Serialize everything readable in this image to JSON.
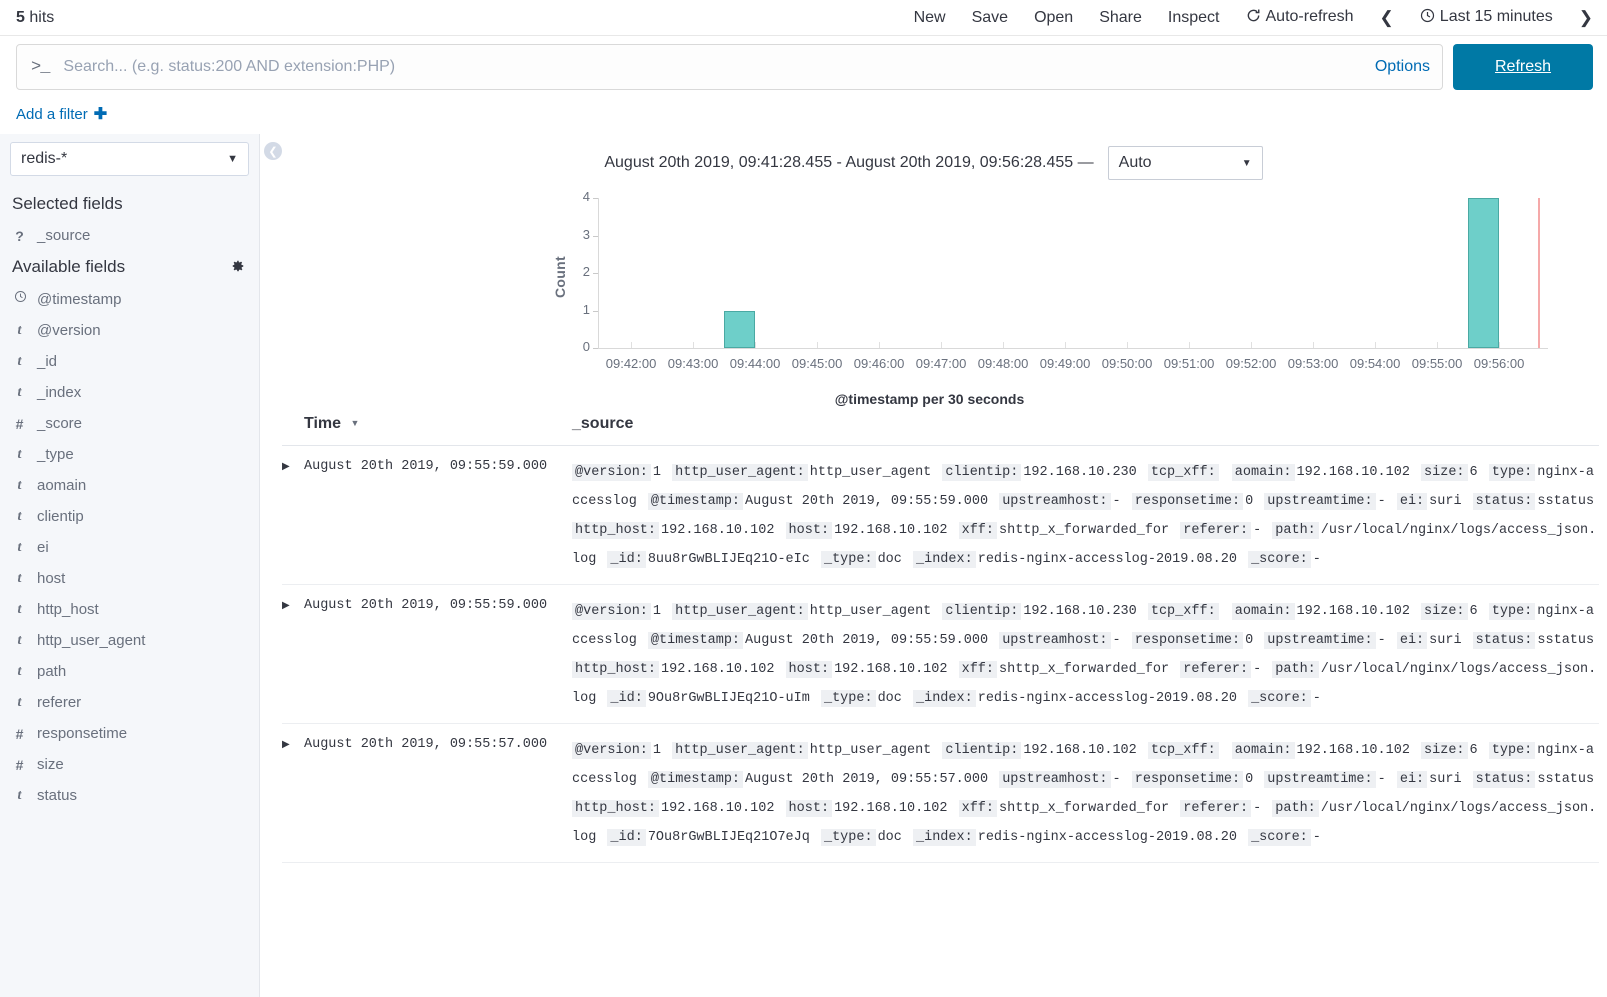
{
  "header": {
    "hits_count": "5",
    "hits_label": "hits",
    "nav": [
      {
        "label": "New",
        "name": "new"
      },
      {
        "label": "Save",
        "name": "save"
      },
      {
        "label": "Open",
        "name": "open"
      },
      {
        "label": "Share",
        "name": "share"
      },
      {
        "label": "Inspect",
        "name": "inspect"
      }
    ],
    "auto_refresh": "Auto-refresh",
    "auto_refresh_icon": "refresh-icon",
    "prev_icon": "chevron-left-icon",
    "next_icon": "chevron-right-icon",
    "time_picker": "Last 15 minutes",
    "clock_icon": "clock-icon"
  },
  "query": {
    "prompt_icon": "console-prompt-icon",
    "placeholder": "Search... (e.g. status:200 AND extension:PHP)",
    "value": "",
    "options_label": "Options",
    "refresh_label": "Refresh"
  },
  "filters": {
    "add_filter_label": "Add a filter",
    "plus_icon": "plus-icon"
  },
  "sidebar": {
    "index_pattern": "redis-*",
    "selected_fields_label": "Selected fields",
    "available_fields_label": "Available fields",
    "settings_icon": "gear-icon",
    "selected_fields": [
      {
        "name": "_source",
        "type": "?"
      }
    ],
    "available_fields": [
      {
        "name": "@timestamp",
        "type": "clock"
      },
      {
        "name": "@version",
        "type": "t"
      },
      {
        "name": "_id",
        "type": "t"
      },
      {
        "name": "_index",
        "type": "t"
      },
      {
        "name": "_score",
        "type": "#"
      },
      {
        "name": "_type",
        "type": "t"
      },
      {
        "name": "aomain",
        "type": "t"
      },
      {
        "name": "clientip",
        "type": "t"
      },
      {
        "name": "ei",
        "type": "t"
      },
      {
        "name": "host",
        "type": "t"
      },
      {
        "name": "http_host",
        "type": "t"
      },
      {
        "name": "http_user_agent",
        "type": "t"
      },
      {
        "name": "path",
        "type": "t"
      },
      {
        "name": "referer",
        "type": "t"
      },
      {
        "name": "responsetime",
        "type": "#"
      },
      {
        "name": "size",
        "type": "#"
      },
      {
        "name": "status",
        "type": "t"
      }
    ]
  },
  "chart_header": {
    "range_text": "August 20th 2019, 09:41:28.455 - August 20th 2019, 09:56:28.455 —",
    "interval": "Auto",
    "collapse_icon": "collapse-left-icon"
  },
  "chart_data": {
    "type": "bar",
    "title": "",
    "xlabel": "@timestamp per 30 seconds",
    "ylabel": "Count",
    "ylim": [
      0,
      4
    ],
    "yticks": [
      0,
      1,
      2,
      3,
      4
    ],
    "xticks": [
      "09:42:00",
      "09:43:00",
      "09:44:00",
      "09:45:00",
      "09:46:00",
      "09:47:00",
      "09:48:00",
      "09:49:00",
      "09:50:00",
      "09:51:00",
      "09:52:00",
      "09:53:00",
      "09:54:00",
      "09:55:00",
      "09:56:00"
    ],
    "x_start": "09:41:28.455",
    "x_end": "09:56:28.455",
    "bar_color": "#6ecfc9",
    "bar_border_color": "#4aa9a3",
    "now_marker_color": "#f5a9a9",
    "grid": false,
    "legend": "none",
    "bars": [
      {
        "x": "09:43:30",
        "value": 1
      },
      {
        "x": "09:55:30",
        "value": 4
      }
    ]
  },
  "doc_table": {
    "columns": [
      {
        "label": "Time",
        "name": "time",
        "sorted": true,
        "sort_icon": "caret-down-icon"
      },
      {
        "label": "_source",
        "name": "source",
        "sorted": false
      }
    ],
    "expand_icon": "caret-right-icon",
    "rows": [
      {
        "time": "August 20th 2019, 09:55:59.000",
        "fields": [
          {
            "key": "@version:",
            "value": "1"
          },
          {
            "key": "http_user_agent:",
            "value": "http_user_agent"
          },
          {
            "key": "clientip:",
            "value": "192.168.10.230"
          },
          {
            "key": "tcp_xff:",
            "value": ""
          },
          {
            "key": "aomain:",
            "value": "192.168.10.102"
          },
          {
            "key": "size:",
            "value": "6"
          },
          {
            "key": "type:",
            "value": "nginx-accesslog"
          },
          {
            "key": "@timestamp:",
            "value": "August 20th 2019, 09:55:59.000"
          },
          {
            "key": "upstreamhost:",
            "value": "-"
          },
          {
            "key": "responsetime:",
            "value": "0"
          },
          {
            "key": "upstreamtime:",
            "value": "-"
          },
          {
            "key": "ei:",
            "value": "suri"
          },
          {
            "key": "status:",
            "value": "sstatus"
          },
          {
            "key": "http_host:",
            "value": "192.168.10.102"
          },
          {
            "key": "host:",
            "value": "192.168.10.102"
          },
          {
            "key": "xff:",
            "value": "shttp_x_forwarded_for"
          },
          {
            "key": "referer:",
            "value": "-"
          },
          {
            "key": "path:",
            "value": "/usr/local/nginx/logs/access_json.log"
          },
          {
            "key": "_id:",
            "value": "8uu8rGwBLIJEq21O-eIc"
          },
          {
            "key": "_type:",
            "value": "doc"
          },
          {
            "key": "_index:",
            "value": "redis-nginx-accesslog-2019.08.20"
          },
          {
            "key": "_score:",
            "value": "-"
          }
        ]
      },
      {
        "time": "August 20th 2019, 09:55:59.000",
        "fields": [
          {
            "key": "@version:",
            "value": "1"
          },
          {
            "key": "http_user_agent:",
            "value": "http_user_agent"
          },
          {
            "key": "clientip:",
            "value": "192.168.10.230"
          },
          {
            "key": "tcp_xff:",
            "value": ""
          },
          {
            "key": "aomain:",
            "value": "192.168.10.102"
          },
          {
            "key": "size:",
            "value": "6"
          },
          {
            "key": "type:",
            "value": "nginx-accesslog"
          },
          {
            "key": "@timestamp:",
            "value": "August 20th 2019, 09:55:59.000"
          },
          {
            "key": "upstreamhost:",
            "value": "-"
          },
          {
            "key": "responsetime:",
            "value": "0"
          },
          {
            "key": "upstreamtime:",
            "value": "-"
          },
          {
            "key": "ei:",
            "value": "suri"
          },
          {
            "key": "status:",
            "value": "sstatus"
          },
          {
            "key": "http_host:",
            "value": "192.168.10.102"
          },
          {
            "key": "host:",
            "value": "192.168.10.102"
          },
          {
            "key": "xff:",
            "value": "shttp_x_forwarded_for"
          },
          {
            "key": "referer:",
            "value": "-"
          },
          {
            "key": "path:",
            "value": "/usr/local/nginx/logs/access_json.log"
          },
          {
            "key": "_id:",
            "value": "9Ou8rGwBLIJEq21O-uIm"
          },
          {
            "key": "_type:",
            "value": "doc"
          },
          {
            "key": "_index:",
            "value": "redis-nginx-accesslog-2019.08.20"
          },
          {
            "key": "_score:",
            "value": "-"
          }
        ]
      },
      {
        "time": "August 20th 2019, 09:55:57.000",
        "fields": [
          {
            "key": "@version:",
            "value": "1"
          },
          {
            "key": "http_user_agent:",
            "value": "http_user_agent"
          },
          {
            "key": "clientip:",
            "value": "192.168.10.102"
          },
          {
            "key": "tcp_xff:",
            "value": ""
          },
          {
            "key": "aomain:",
            "value": "192.168.10.102"
          },
          {
            "key": "size:",
            "value": "6"
          },
          {
            "key": "type:",
            "value": "nginx-accesslog"
          },
          {
            "key": "@timestamp:",
            "value": "August 20th 2019, 09:55:57.000"
          },
          {
            "key": "upstreamhost:",
            "value": "-"
          },
          {
            "key": "responsetime:",
            "value": "0"
          },
          {
            "key": "upstreamtime:",
            "value": "-"
          },
          {
            "key": "ei:",
            "value": "suri"
          },
          {
            "key": "status:",
            "value": "sstatus"
          },
          {
            "key": "http_host:",
            "value": "192.168.10.102"
          },
          {
            "key": "host:",
            "value": "192.168.10.102"
          },
          {
            "key": "xff:",
            "value": "shttp_x_forwarded_for"
          },
          {
            "key": "referer:",
            "value": "-"
          },
          {
            "key": "path:",
            "value": "/usr/local/nginx/logs/access_json.log"
          },
          {
            "key": "_id:",
            "value": "7Ou8rGwBLIJEq21O7eJq"
          },
          {
            "key": "_type:",
            "value": "doc"
          },
          {
            "key": "_index:",
            "value": "redis-nginx-accesslog-2019.08.20"
          },
          {
            "key": "_score:",
            "value": "-"
          }
        ]
      }
    ]
  }
}
